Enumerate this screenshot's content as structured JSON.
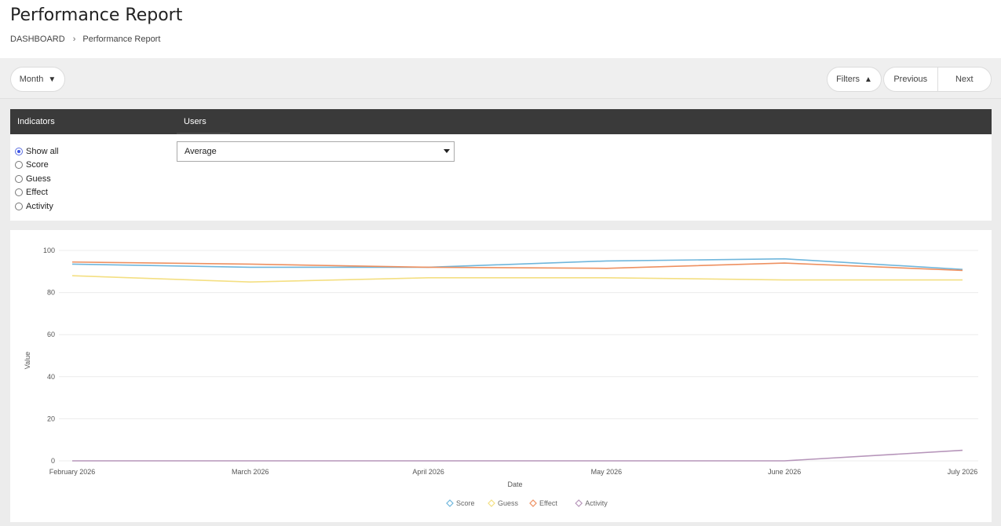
{
  "header": {
    "title": "Performance Report",
    "breadcrumb": [
      "DASHBOARD",
      "Performance Report"
    ]
  },
  "toolbar": {
    "period_label": "Month",
    "filters_label": "Filters",
    "previous_label": "Previous",
    "next_label": "Next"
  },
  "panel": {
    "indicators_header": "Indicators",
    "users_header": "Users",
    "indicator_options": [
      "Show all",
      "Score",
      "Guess",
      "Effect",
      "Activity"
    ],
    "selected_indicator": "Show all",
    "users_select_value": "Average"
  },
  "colors": {
    "Score": "#6fb6dc",
    "Guess": "#f4df82",
    "Effect": "#ee9060",
    "Activity": "#b695ba",
    "panel_header": "#3a3a3a",
    "radio_accent": "#3d55e6"
  },
  "chart_data": {
    "type": "line",
    "xlabel": "Date",
    "ylabel": "Value",
    "categories": [
      "February 2026",
      "March 2026",
      "April 2026",
      "May 2026",
      "June 2026",
      "July 2026"
    ],
    "ylim": [
      0,
      100
    ],
    "yticks": [
      0,
      20,
      40,
      60,
      80,
      100
    ],
    "grid": true,
    "legend_position": "bottom-center",
    "series": [
      {
        "name": "Score",
        "values": [
          93.5,
          92,
          92,
          95,
          96,
          91
        ]
      },
      {
        "name": "Guess",
        "values": [
          88,
          85,
          87,
          87,
          86,
          86
        ]
      },
      {
        "name": "Effect",
        "values": [
          94.5,
          93.5,
          92,
          91.5,
          94,
          90.5
        ]
      },
      {
        "name": "Activity",
        "values": [
          0,
          0,
          0,
          0,
          0,
          5
        ]
      }
    ]
  }
}
